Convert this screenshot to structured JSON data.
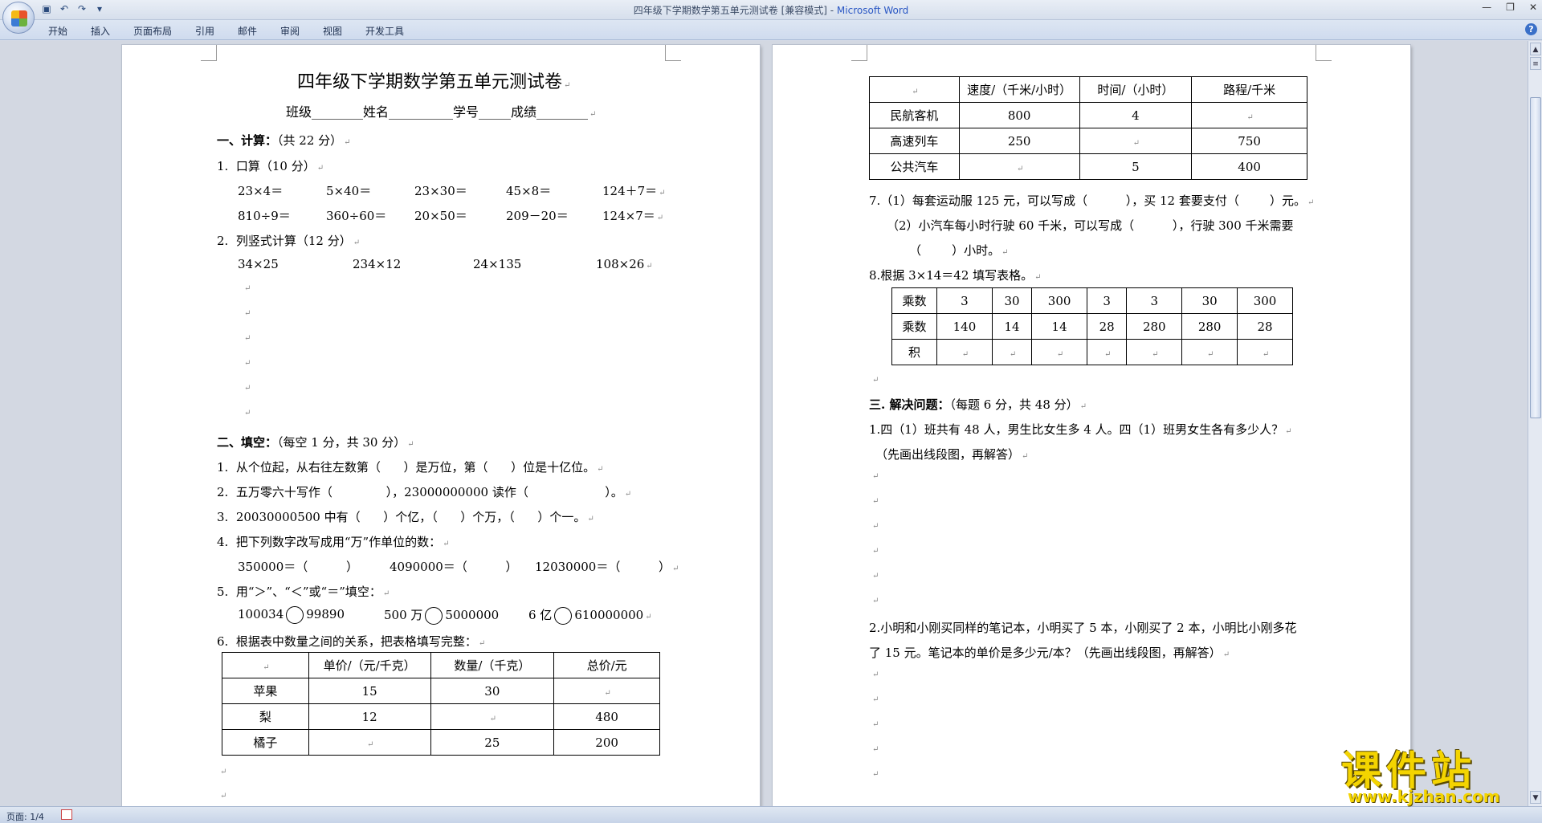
{
  "window": {
    "title": "四年级下学期数学第五单元测试卷 [兼容模式] - ",
    "app": "Microsoft Word"
  },
  "qat_icons": [
    "save-icon",
    "undo-icon",
    "redo-icon",
    "customize-icon"
  ],
  "ribbon": {
    "tabs": [
      "开始",
      "插入",
      "页面布局",
      "引用",
      "邮件",
      "审阅",
      "视图",
      "开发工具"
    ]
  },
  "page1": {
    "title": "四年级下学期数学第五单元测试卷",
    "info": "班级________姓名__________学号_____成绩________",
    "s1": "一、计算：",
    "s1_note": "（共 22 分）",
    "q1": "1.  口算（10 分）",
    "row1": [
      "23×4＝",
      "5×40＝",
      "23×30＝",
      "45×8＝",
      "124＋7＝"
    ],
    "row2": [
      "810÷9＝",
      "360÷60＝",
      "20×50＝",
      "209－20＝",
      "124×7＝"
    ],
    "q2": "2.  列竖式计算（12 分）",
    "row3": [
      "34×25",
      "234×12",
      "24×135",
      "108×26"
    ],
    "s2": "二、填空：",
    "s2_note": "（每空 1 分，共 30 分）",
    "f1": "1.  从个位起，从右往左数第（      ）是万位，第（      ）位是十亿位。",
    "f2": "2.  五万零六十写作（              ），23000000000 读作（                    ）。",
    "f3": "3.  20030000500 中有（      ）个亿，（      ）个万，（      ）个一。",
    "f4": "4.  把下列数字改写成用“万”作单位的数：",
    "f4a": "350000＝（          ）",
    "f4b": "4090000＝（          ）",
    "f4c": "12030000＝（          ）",
    "f5": "5.  用“＞”、“＜”或“＝”填空：",
    "f5a1": "100034",
    "f5a2": "99890",
    "f5b1": "500 万",
    "f5b2": "5000000",
    "f5c1": "6 亿",
    "f5c2": "610000000",
    "f6": "6.  根据表中数量之间的关系，把表格填写完整：",
    "table": {
      "header": [
        "",
        "单价/（元/千克）",
        "数量/（千克）",
        "总价/元"
      ],
      "rows": [
        [
          "苹果",
          "15",
          "30",
          ""
        ],
        [
          "梨",
          "12",
          "",
          "480"
        ],
        [
          "橘子",
          "",
          "25",
          "200"
        ]
      ]
    }
  },
  "page2": {
    "table": {
      "header": [
        "",
        "速度/（千米/小时）",
        "时间/（小时）",
        "路程/千米"
      ],
      "rows": [
        [
          "民航客机",
          "800",
          "4",
          ""
        ],
        [
          "高速列车",
          "250",
          "",
          "750"
        ],
        [
          "公共汽车",
          "",
          "5",
          "400"
        ]
      ]
    },
    "q7a": "7.（1）每套运动服 125 元，可以写成（          ），买 12 套要支付（        ）元。",
    "q7b": "（2）小汽车每小时行驶 60 千米，可以写成（          ），行驶 300 千米需要",
    "q7c": "（        ）小时。",
    "q8": "8.根据 3×14＝42 填写表格。",
    "table2": {
      "rows": [
        [
          "乘数",
          "3",
          "30",
          "300",
          "3",
          "3",
          "30",
          "300"
        ],
        [
          "乘数",
          "140",
          "14",
          "14",
          "28",
          "280",
          "280",
          "28"
        ],
        [
          "积",
          "",
          "",
          "",
          "",
          "",
          "",
          ""
        ]
      ]
    },
    "s3": "三. 解决问题：",
    "s3_note": "（每题 6 分，共 48 分）",
    "p1a": "1.四（1）班共有 48 人，男生比女生多 4 人。四（1）班男女生各有多少人？",
    "p1b": "（先画出线段图，再解答）",
    "p2a": "2.小明和小刚买同样的笔记本，小明买了 5 本，小刚买了 2 本，小明比小刚多花",
    "p2b": "了 15 元。笔记本的单价是多少元/本？（先画出线段图，再解答）"
  },
  "paragraph_mark": "↵",
  "statusbar": {
    "page": "页面: 1/4"
  },
  "watermark": {
    "text": "课件站",
    "url": "www.kjzhan.com"
  }
}
